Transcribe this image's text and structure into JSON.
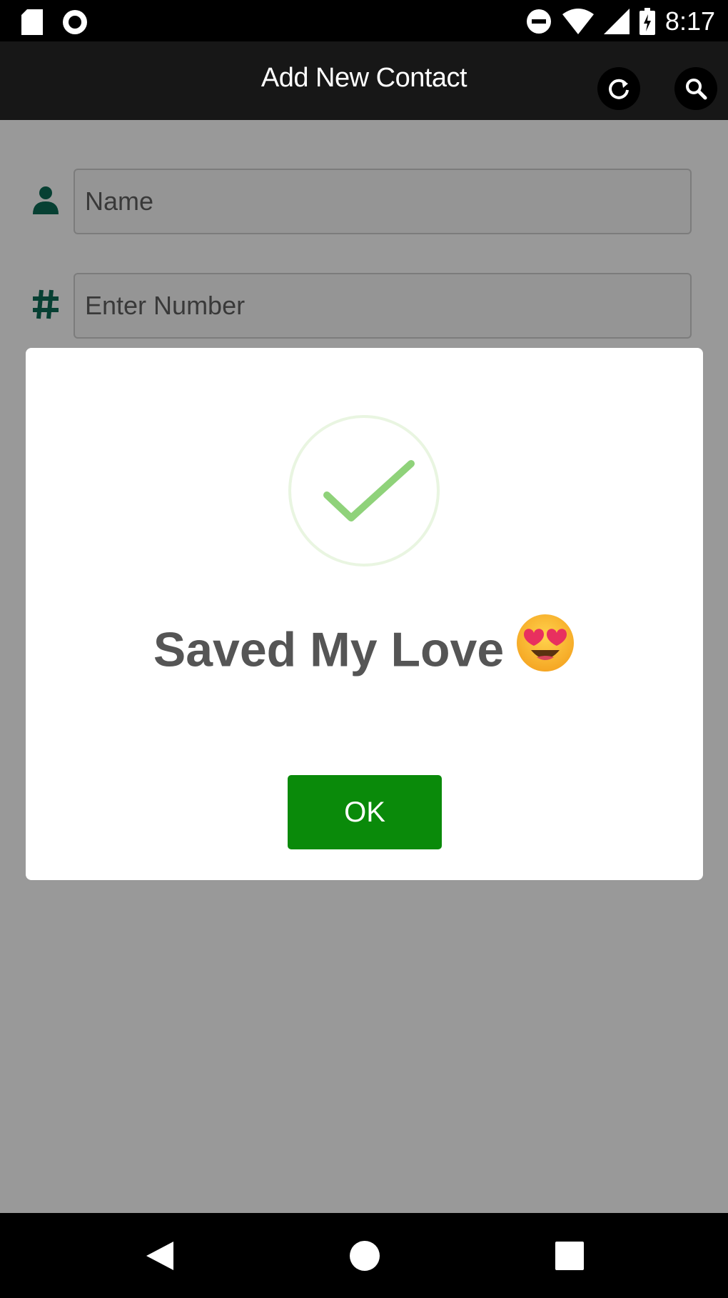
{
  "status_bar": {
    "time": "8:17",
    "left_icons": [
      "sd-card-icon",
      "sync-circle-icon"
    ],
    "right_icons": [
      "do-not-disturb-icon",
      "wifi-icon",
      "signal-icon",
      "battery-charging-icon"
    ]
  },
  "app_bar": {
    "title": "Add New Contact",
    "actions": [
      "refresh-icon",
      "search-icon"
    ]
  },
  "form": {
    "name_placeholder": "Name",
    "number_placeholder": "Enter Number",
    "accent_color": "#0d6b55"
  },
  "dialog": {
    "message": "Saved My Love",
    "emoji": "smiling-face-with-heart-eyes-icon",
    "ok_label": "OK",
    "check_color": "#8fd27a",
    "button_color": "#0a8a0a"
  },
  "nav_bar": {
    "buttons": [
      "back-icon",
      "home-icon",
      "recents-icon"
    ]
  }
}
